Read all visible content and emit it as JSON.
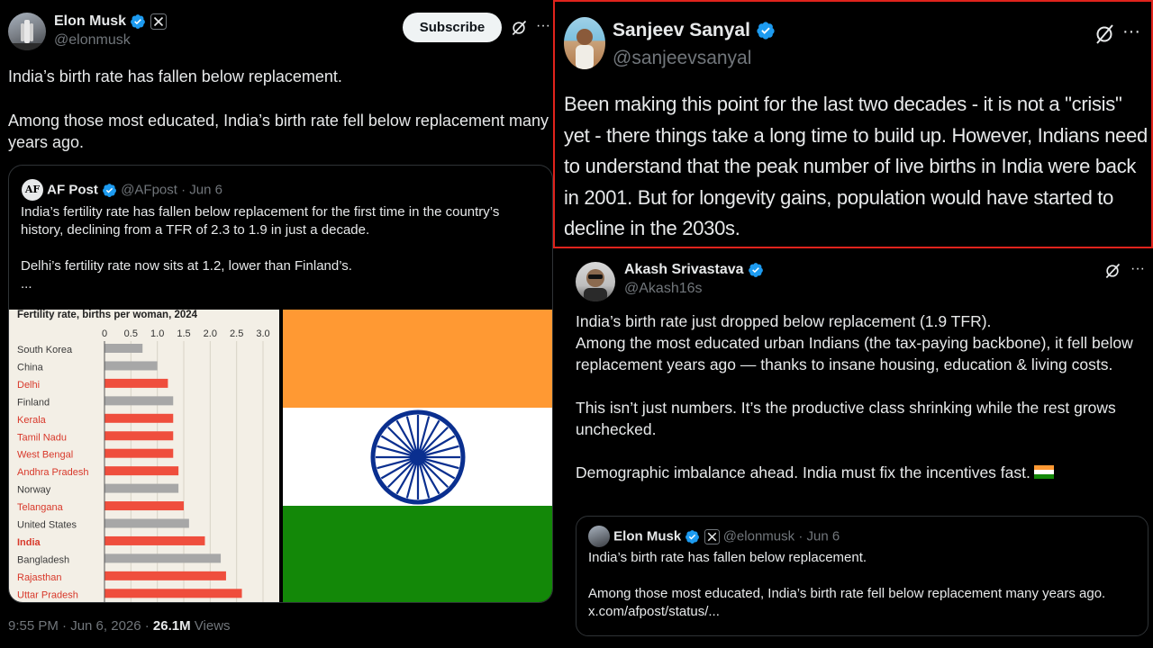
{
  "left_tweet": {
    "author_name": "Elon Musk",
    "author_handle": "@elonmusk",
    "subscribe_label": "Subscribe",
    "more_label": "···",
    "paragraph1": "India’s birth rate has fallen below replacement.",
    "paragraph2": "Among those most educated, India’s birth rate fell below replacement many years ago.",
    "quote": {
      "avatar_text": "AF",
      "author_name": "AF Post",
      "author_handle": "@AFpost",
      "date": "· Jun 6",
      "paragraph1": "India’s fertility rate has fallen below replacement for the first time in the country’s history, declining from a TFR of 2.3 to 1.9 in just a decade.",
      "paragraph2": "Delhi’s fertility rate now sits at 1.2, lower than Finland’s.",
      "ellipsis": "..."
    },
    "meta": {
      "time": "9:55 PM · Jun 6, 2026 · ",
      "views_count": "26.1M",
      "views_label": " Views"
    }
  },
  "chart_data": {
    "type": "bar",
    "orientation": "horizontal",
    "title": "Fertility rate, births per woman, 2024",
    "xlim": [
      0,
      3.0
    ],
    "xticks": [
      "0",
      "0.5",
      "1.0",
      "1.5",
      "2.0",
      "2.5",
      "3.0"
    ],
    "categories": [
      "South Korea",
      "China",
      "Delhi",
      "Finland",
      "Kerala",
      "Tamil Nadu",
      "West Bengal",
      "Andhra Pradesh",
      "Norway",
      "Telangana",
      "United States",
      "India",
      "Bangladesh",
      "Rajasthan",
      "Uttar Pradesh"
    ],
    "values": [
      0.72,
      1.0,
      1.2,
      1.3,
      1.3,
      1.3,
      1.3,
      1.4,
      1.4,
      1.5,
      1.6,
      1.9,
      2.2,
      2.3,
      2.6
    ],
    "highlight": [
      false,
      false,
      true,
      false,
      true,
      true,
      true,
      true,
      false,
      true,
      false,
      true,
      false,
      true,
      true
    ],
    "colors": {
      "highlight": "#ef4e3d",
      "other": "#a7a7a7",
      "label_highlight": "#d8382a",
      "label_other": "#3a3a3a",
      "background": "#f3efe6"
    }
  },
  "right_top_tweet": {
    "author_name": "Sanjeev Sanyal",
    "author_handle": "@sanjeevsanyal",
    "more_label": "···",
    "text": "Been making this point for the last two decades - it is not a \"crisis\" yet - there things take a long time to build up. However, Indians need to understand that the peak number of live births in India were back in 2001. But for longevity gains, population would have started to decline in the 2030s."
  },
  "right_bottom_tweet": {
    "author_name": "Akash Srivastava",
    "author_handle": "@Akash16s",
    "more_label": "···",
    "line1": "India’s birth rate just dropped below replacement (1.9 TFR).",
    "line2": "Among the most educated urban Indians (the tax-paying backbone), it fell below replacement years ago — thanks to insane housing, education & living costs.",
    "para2": "This isn’t just numbers. It’s the productive class shrinking while the rest grows unchecked.",
    "para3": "Demographic imbalance ahead. India must fix the incentives fast.",
    "quote": {
      "author_name": "Elon Musk",
      "author_handle": "@elonmusk",
      "date": "· Jun 6",
      "paragraph1": "India’s birth rate has fallen below replacement.",
      "paragraph2": "Among those most educated, India’s birth rate fell below replacement many years ago. x.com/afpost/status/..."
    }
  },
  "colors": {
    "verified": "#1d9bf0",
    "highlight_border": "#e0231c",
    "flag_orange": "#ff9933",
    "flag_green": "#138808",
    "chakra": "#0a2f8f"
  }
}
